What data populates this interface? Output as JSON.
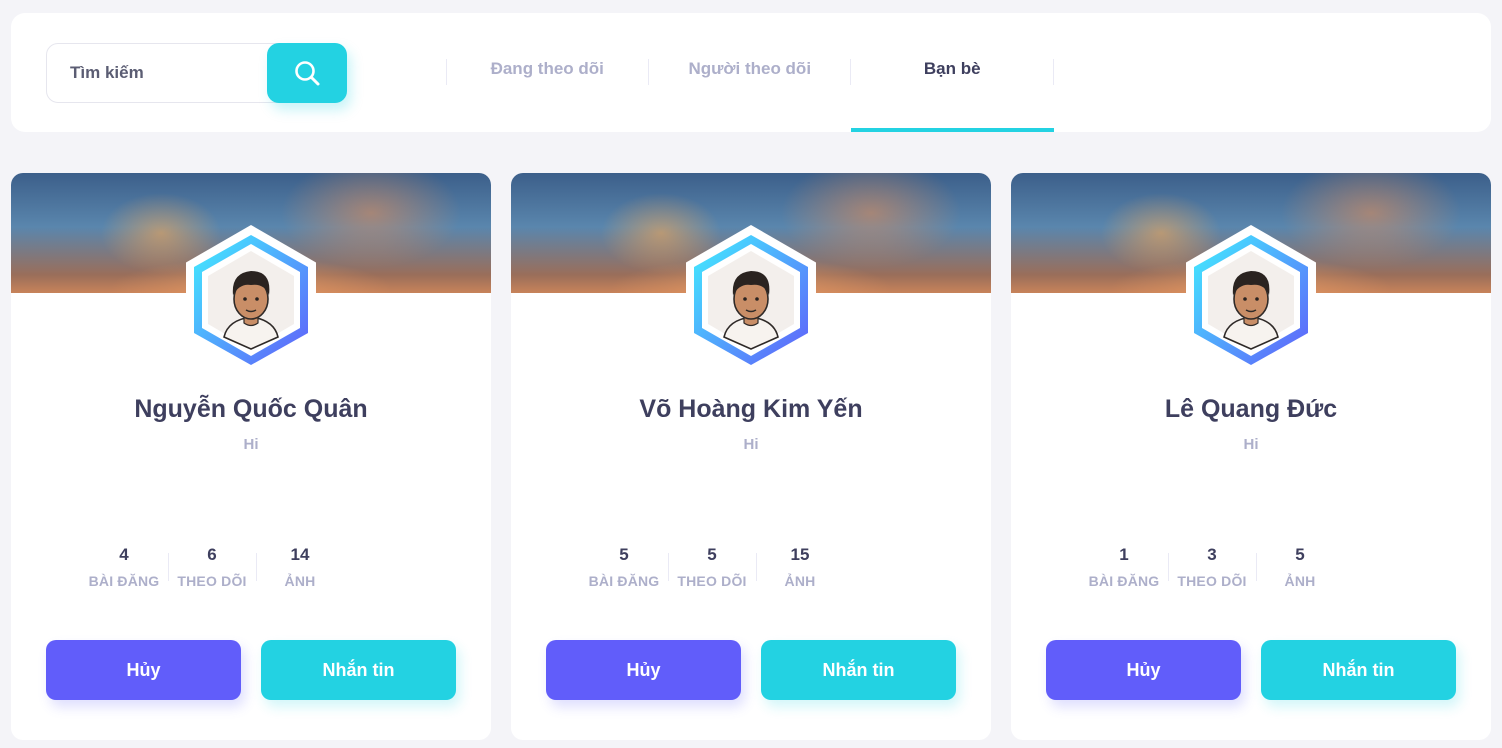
{
  "search": {
    "placeholder": "Tìm kiếm"
  },
  "tabs": [
    {
      "label": "Đang theo dõi",
      "active": false
    },
    {
      "label": "Người theo dõi",
      "active": false
    },
    {
      "label": "Bạn bè",
      "active": true
    }
  ],
  "colors": {
    "accent": "#23d2e2",
    "primary": "#615dfa",
    "text": "#3e3f5e",
    "muted": "#adafca"
  },
  "friends": [
    {
      "name": "Nguyễn Quốc Quân",
      "status": "Hi",
      "stats": [
        {
          "value": "4",
          "label": "BÀI ĐĂNG"
        },
        {
          "value": "6",
          "label": "THEO DÕI"
        },
        {
          "value": "14",
          "label": "ẢNH"
        }
      ],
      "cancel_label": "Hủy",
      "message_label": "Nhắn tin"
    },
    {
      "name": "Võ Hoàng Kim Yến",
      "status": "Hi",
      "stats": [
        {
          "value": "5",
          "label": "BÀI ĐĂNG"
        },
        {
          "value": "5",
          "label": "THEO DÕI"
        },
        {
          "value": "15",
          "label": "ẢNH"
        }
      ],
      "cancel_label": "Hủy",
      "message_label": "Nhắn tin"
    },
    {
      "name": "Lê Quang Đức",
      "status": "Hi",
      "stats": [
        {
          "value": "1",
          "label": "BÀI ĐĂNG"
        },
        {
          "value": "3",
          "label": "THEO DÕI"
        },
        {
          "value": "5",
          "label": "ẢNH"
        }
      ],
      "cancel_label": "Hủy",
      "message_label": "Nhắn tin"
    }
  ]
}
